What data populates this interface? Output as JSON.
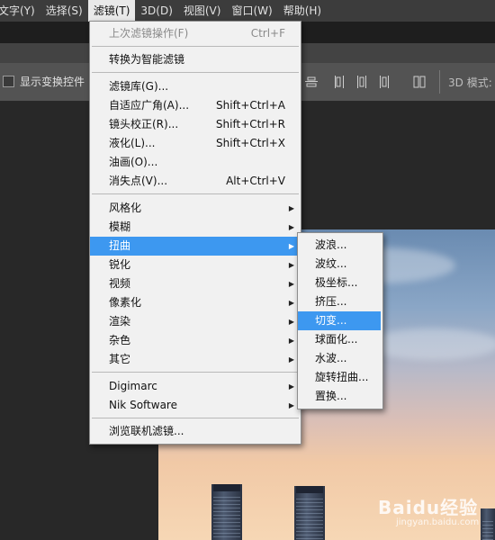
{
  "menubar": {
    "items": [
      "文字(Y)",
      "选择(S)",
      "滤镜(T)",
      "3D(D)",
      "视图(V)",
      "窗口(W)",
      "帮助(H)"
    ],
    "active_index": 2
  },
  "options_bar": {
    "show_transform_controls": "显示变换控件",
    "mode_3d": "3D 模式:",
    "align_icons": [
      "align-center-icon",
      "distribute-left-icon",
      "distribute-center-icon",
      "distribute-right-icon",
      "auto-align-icon"
    ]
  },
  "filter_menu": {
    "last_filter": "上次滤镜操作(F)",
    "last_filter_shortcut": "Ctrl+F",
    "convert_smart": "转换为智能滤镜",
    "gallery": "滤镜库(G)...",
    "adaptive_wide_angle": "自适应广角(A)...",
    "adaptive_wide_angle_shortcut": "Shift+Ctrl+A",
    "lens_correction": "镜头校正(R)...",
    "lens_correction_shortcut": "Shift+Ctrl+R",
    "liquify": "液化(L)...",
    "liquify_shortcut": "Shift+Ctrl+X",
    "oil_paint": "油画(O)...",
    "vanishing_point": "消失点(V)...",
    "vanishing_point_shortcut": "Alt+Ctrl+V",
    "stylize": "风格化",
    "blur": "模糊",
    "distort": "扭曲",
    "sharpen": "锐化",
    "video": "视频",
    "pixelate": "像素化",
    "render": "渲染",
    "noise": "杂色",
    "other": "其它",
    "digimarc": "Digimarc",
    "nik": "Nik Software",
    "browse_online": "浏览联机滤镜..."
  },
  "distort_submenu": {
    "items": [
      "波浪...",
      "波纹...",
      "极坐标...",
      "挤压...",
      "切变...",
      "球面化...",
      "水波...",
      "旋转扭曲...",
      "置换..."
    ],
    "highlighted_index": 4
  },
  "watermark": {
    "brand": "Baidu经验",
    "url": "jingyan.baidu.com"
  }
}
